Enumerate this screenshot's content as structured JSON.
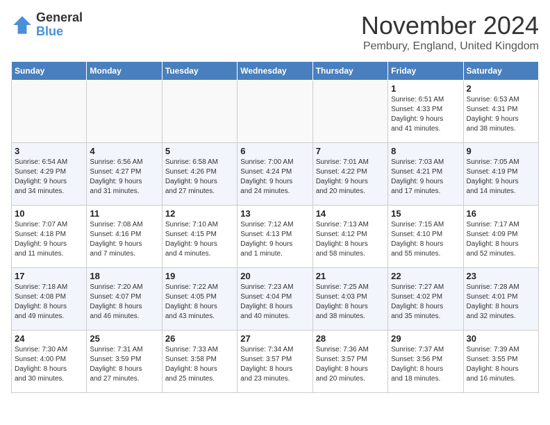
{
  "header": {
    "logo_line1": "General",
    "logo_line2": "Blue",
    "main_title": "November 2024",
    "subtitle": "Pembury, England, United Kingdom"
  },
  "weekdays": [
    "Sunday",
    "Monday",
    "Tuesday",
    "Wednesday",
    "Thursday",
    "Friday",
    "Saturday"
  ],
  "weeks": [
    [
      {
        "day": "",
        "info": ""
      },
      {
        "day": "",
        "info": ""
      },
      {
        "day": "",
        "info": ""
      },
      {
        "day": "",
        "info": ""
      },
      {
        "day": "",
        "info": ""
      },
      {
        "day": "1",
        "info": "Sunrise: 6:51 AM\nSunset: 4:33 PM\nDaylight: 9 hours\nand 41 minutes."
      },
      {
        "day": "2",
        "info": "Sunrise: 6:53 AM\nSunset: 4:31 PM\nDaylight: 9 hours\nand 38 minutes."
      }
    ],
    [
      {
        "day": "3",
        "info": "Sunrise: 6:54 AM\nSunset: 4:29 PM\nDaylight: 9 hours\nand 34 minutes."
      },
      {
        "day": "4",
        "info": "Sunrise: 6:56 AM\nSunset: 4:27 PM\nDaylight: 9 hours\nand 31 minutes."
      },
      {
        "day": "5",
        "info": "Sunrise: 6:58 AM\nSunset: 4:26 PM\nDaylight: 9 hours\nand 27 minutes."
      },
      {
        "day": "6",
        "info": "Sunrise: 7:00 AM\nSunset: 4:24 PM\nDaylight: 9 hours\nand 24 minutes."
      },
      {
        "day": "7",
        "info": "Sunrise: 7:01 AM\nSunset: 4:22 PM\nDaylight: 9 hours\nand 20 minutes."
      },
      {
        "day": "8",
        "info": "Sunrise: 7:03 AM\nSunset: 4:21 PM\nDaylight: 9 hours\nand 17 minutes."
      },
      {
        "day": "9",
        "info": "Sunrise: 7:05 AM\nSunset: 4:19 PM\nDaylight: 9 hours\nand 14 minutes."
      }
    ],
    [
      {
        "day": "10",
        "info": "Sunrise: 7:07 AM\nSunset: 4:18 PM\nDaylight: 9 hours\nand 11 minutes."
      },
      {
        "day": "11",
        "info": "Sunrise: 7:08 AM\nSunset: 4:16 PM\nDaylight: 9 hours\nand 7 minutes."
      },
      {
        "day": "12",
        "info": "Sunrise: 7:10 AM\nSunset: 4:15 PM\nDaylight: 9 hours\nand 4 minutes."
      },
      {
        "day": "13",
        "info": "Sunrise: 7:12 AM\nSunset: 4:13 PM\nDaylight: 9 hours\nand 1 minute."
      },
      {
        "day": "14",
        "info": "Sunrise: 7:13 AM\nSunset: 4:12 PM\nDaylight: 8 hours\nand 58 minutes."
      },
      {
        "day": "15",
        "info": "Sunrise: 7:15 AM\nSunset: 4:10 PM\nDaylight: 8 hours\nand 55 minutes."
      },
      {
        "day": "16",
        "info": "Sunrise: 7:17 AM\nSunset: 4:09 PM\nDaylight: 8 hours\nand 52 minutes."
      }
    ],
    [
      {
        "day": "17",
        "info": "Sunrise: 7:18 AM\nSunset: 4:08 PM\nDaylight: 8 hours\nand 49 minutes."
      },
      {
        "day": "18",
        "info": "Sunrise: 7:20 AM\nSunset: 4:07 PM\nDaylight: 8 hours\nand 46 minutes."
      },
      {
        "day": "19",
        "info": "Sunrise: 7:22 AM\nSunset: 4:05 PM\nDaylight: 8 hours\nand 43 minutes."
      },
      {
        "day": "20",
        "info": "Sunrise: 7:23 AM\nSunset: 4:04 PM\nDaylight: 8 hours\nand 40 minutes."
      },
      {
        "day": "21",
        "info": "Sunrise: 7:25 AM\nSunset: 4:03 PM\nDaylight: 8 hours\nand 38 minutes."
      },
      {
        "day": "22",
        "info": "Sunrise: 7:27 AM\nSunset: 4:02 PM\nDaylight: 8 hours\nand 35 minutes."
      },
      {
        "day": "23",
        "info": "Sunrise: 7:28 AM\nSunset: 4:01 PM\nDaylight: 8 hours\nand 32 minutes."
      }
    ],
    [
      {
        "day": "24",
        "info": "Sunrise: 7:30 AM\nSunset: 4:00 PM\nDaylight: 8 hours\nand 30 minutes."
      },
      {
        "day": "25",
        "info": "Sunrise: 7:31 AM\nSunset: 3:59 PM\nDaylight: 8 hours\nand 27 minutes."
      },
      {
        "day": "26",
        "info": "Sunrise: 7:33 AM\nSunset: 3:58 PM\nDaylight: 8 hours\nand 25 minutes."
      },
      {
        "day": "27",
        "info": "Sunrise: 7:34 AM\nSunset: 3:57 PM\nDaylight: 8 hours\nand 23 minutes."
      },
      {
        "day": "28",
        "info": "Sunrise: 7:36 AM\nSunset: 3:57 PM\nDaylight: 8 hours\nand 20 minutes."
      },
      {
        "day": "29",
        "info": "Sunrise: 7:37 AM\nSunset: 3:56 PM\nDaylight: 8 hours\nand 18 minutes."
      },
      {
        "day": "30",
        "info": "Sunrise: 7:39 AM\nSunset: 3:55 PM\nDaylight: 8 hours\nand 16 minutes."
      }
    ]
  ]
}
